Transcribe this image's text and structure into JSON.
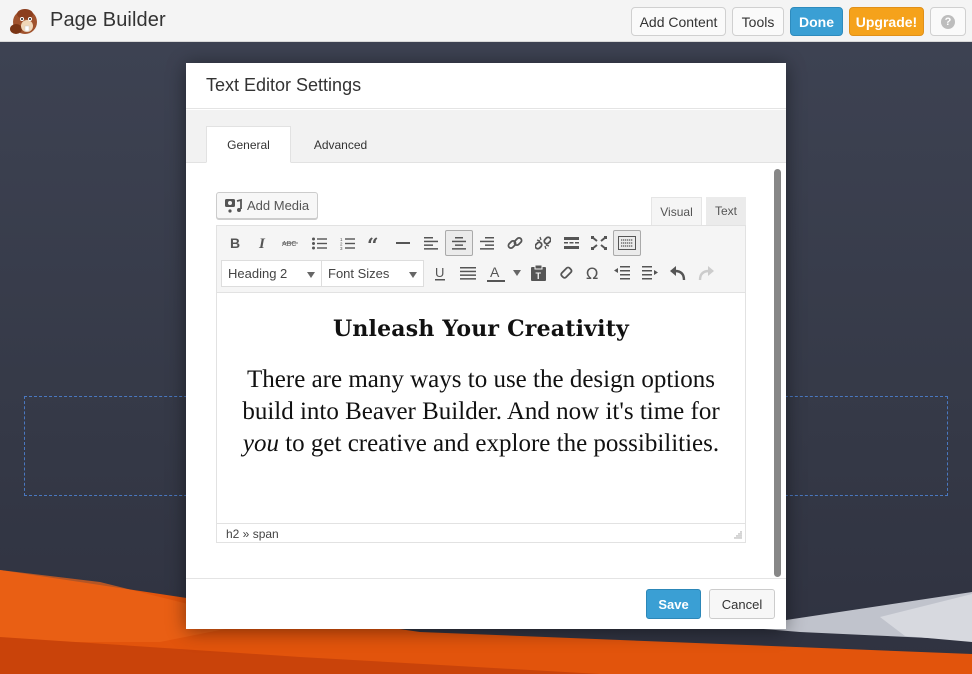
{
  "app": {
    "title": "Page Builder",
    "logo_icon": "beaver-logo-icon"
  },
  "topbar": {
    "buttons": [
      {
        "label": "Add Content",
        "style": "default"
      },
      {
        "label": "Tools",
        "style": "default"
      },
      {
        "label": "Done",
        "style": "primary"
      },
      {
        "label": "Upgrade!",
        "style": "warning"
      }
    ],
    "help_icon": "question-circle-icon",
    "help_glyph": "?"
  },
  "colors": {
    "primary": "#3a9fd4",
    "upgrade": "#f5a21b",
    "background": "#383c4a",
    "accent_orange": "#e8580c",
    "drop_zone_border": "#4a78c0"
  },
  "modal": {
    "title": "Text Editor Settings",
    "tabs": [
      {
        "label": "General",
        "active": true
      },
      {
        "label": "Advanced",
        "active": false
      }
    ],
    "editor": {
      "add_media_label": "Add Media",
      "mode_tabs": [
        {
          "label": "Visual",
          "active": true
        },
        {
          "label": "Text",
          "active": false
        }
      ],
      "toolbar_row1": [
        {
          "icon": "bold-icon",
          "pressed": false
        },
        {
          "icon": "italic-icon",
          "pressed": false
        },
        {
          "icon": "strikethrough-icon",
          "pressed": false
        },
        {
          "icon": "bulleted-list-icon",
          "pressed": false
        },
        {
          "icon": "numbered-list-icon",
          "pressed": false
        },
        {
          "icon": "blockquote-icon",
          "pressed": false
        },
        {
          "icon": "horizontal-line-icon",
          "pressed": false
        },
        {
          "icon": "align-left-icon",
          "pressed": false
        },
        {
          "icon": "align-center-icon",
          "pressed": true
        },
        {
          "icon": "align-right-icon",
          "pressed": false
        },
        {
          "icon": "link-icon",
          "pressed": false
        },
        {
          "icon": "unlink-icon",
          "pressed": false
        },
        {
          "icon": "read-more-icon",
          "pressed": false
        },
        {
          "icon": "fullscreen-icon",
          "pressed": false
        },
        {
          "icon": "toolbar-toggle-icon",
          "pressed": true
        }
      ],
      "format_select": "Heading 2",
      "font_size_select": "Font Sizes",
      "toolbar_row2": [
        {
          "icon": "underline-icon"
        },
        {
          "icon": "justify-icon"
        },
        {
          "icon": "text-color-icon"
        },
        {
          "icon": "color-dropdown-icon"
        },
        {
          "icon": "paste-as-text-icon"
        },
        {
          "icon": "clear-formatting-icon"
        },
        {
          "icon": "special-character-icon"
        },
        {
          "icon": "outdent-icon"
        },
        {
          "icon": "indent-icon"
        },
        {
          "icon": "undo-icon"
        },
        {
          "icon": "redo-icon"
        }
      ],
      "content": {
        "heading": "Unleash Your Creativity",
        "paragraph_before": "There are many ways to use the design options build into Beaver Builder. And now it's time for ",
        "paragraph_emphasis": "you",
        "paragraph_after": " to get creative and explore the possibilities."
      },
      "status_path": "h2 » span"
    },
    "footer": {
      "save_label": "Save",
      "cancel_label": "Cancel"
    }
  }
}
